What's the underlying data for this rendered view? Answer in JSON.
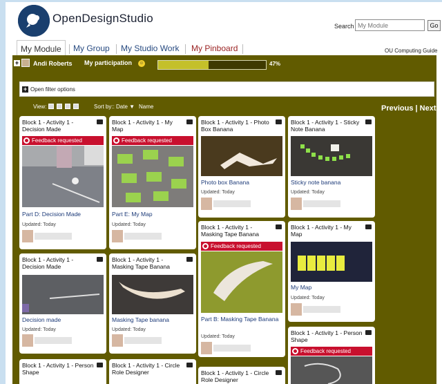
{
  "header": {
    "site_title": "OpenDesignStudio",
    "search_label": "Search",
    "search_placeholder": "My Module",
    "go_label": "Go",
    "ou_guide": "OU Computing Guide"
  },
  "tabs": [
    {
      "label": "My Module",
      "active": true
    },
    {
      "label": "My Group",
      "active": false
    },
    {
      "label": "My Studio Work",
      "active": false
    },
    {
      "label": "My Pinboard",
      "active": false
    }
  ],
  "participation": {
    "user_name": "Andi Roberts",
    "label": "My participation",
    "percent_text": "47%",
    "percent": 0.47
  },
  "filter": {
    "label": "Open filter options"
  },
  "toolbar": {
    "view_label": "View:",
    "sort_label": "Sort by:: Date",
    "name_label": "Name",
    "pagination": "Previous | Next"
  },
  "cards": [
    {
      "title": "Block 1 - Activity 1 - Decision Made",
      "feedback": "Feedback requested",
      "item": "Part D: Decision Made",
      "updated": "Updated: Today"
    },
    {
      "title": "Block 1 - Activity 1 - My Map",
      "feedback": "Feedback requested",
      "item": "Part E: My Map",
      "updated": "Updated: Today"
    },
    {
      "title": "Block 1 - Activity 1 - Photo Box Banana",
      "item": "Photo box Banana",
      "updated": "Updated: Today"
    },
    {
      "title": "Block 1 - Activity 1 - Sticky Note Banana",
      "item": "Sticky note banana",
      "updated": "Updated: Today"
    },
    {
      "title": "Block 1 - Activity 1 - Decision Made",
      "item": "Decision made",
      "updated": "Updated: Today"
    },
    {
      "title": "Block 1 - Activity 1 - Masking Tape Banana",
      "item": "Masking Tape banana",
      "updated": "Updated: Today"
    },
    {
      "title": "Block 1 - Activity 1 - Masking Tape Banana",
      "feedback": "Feedback requested",
      "item": "Part B: Masking Tape Banana",
      "updated": "Updated: Today"
    },
    {
      "title": "Block 1 - Activity 1 - My Map",
      "item": "My Map",
      "updated": "Updated: Today"
    },
    {
      "title": "Block 1 - Activity 1 - Person Shape",
      "feedback": "Feedback requested"
    },
    {
      "title": "Block 1 - Activity 1 - Person Shape"
    },
    {
      "title": "Block 1 - Activity 1 - Circle Role Designer"
    },
    {
      "title": "Block 1 - Activity 1 - Circle Role Designer"
    }
  ],
  "colors": {
    "olive_background": "#615b00",
    "feedback_red": "#c8102e",
    "link_blue": "#1c3a78",
    "progress_fill": "#c4c02a"
  }
}
